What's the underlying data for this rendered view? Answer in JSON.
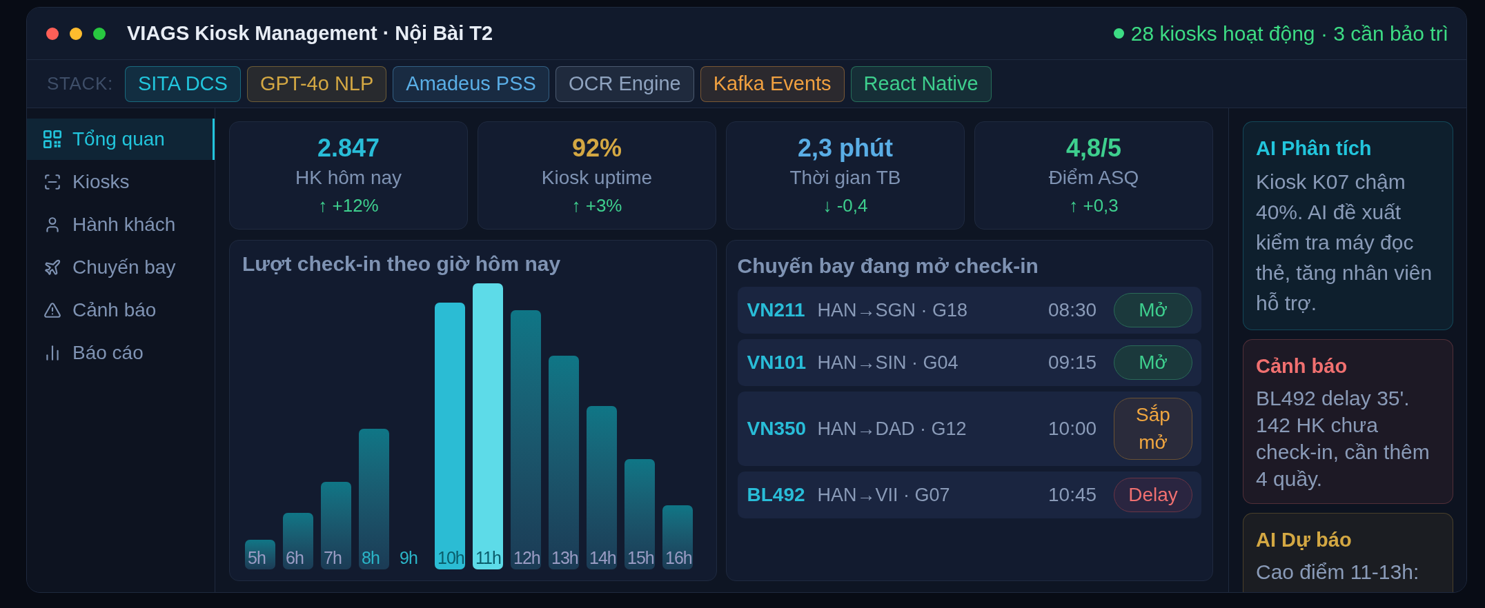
{
  "window": {
    "title": "VIAGS Kiosk Management · Nội Bài T2",
    "status": "28 kiosks hoạt động · 3 cần bảo trì"
  },
  "stack": {
    "label": "STACK:",
    "chips": [
      {
        "label": "SITA DCS",
        "color": "#22c5dc"
      },
      {
        "label": "GPT-4o NLP",
        "color": "#d4a843"
      },
      {
        "label": "Amadeus PSS",
        "color": "#5aaee6"
      },
      {
        "label": "OCR Engine",
        "color": "#8fa3bf"
      },
      {
        "label": "Kafka Events",
        "color": "#f0a040"
      },
      {
        "label": "React Native",
        "color": "#3ecf8e"
      }
    ]
  },
  "sidebar": {
    "items": [
      {
        "label": "Tổng quan",
        "selected": true
      },
      {
        "label": "Kiosks",
        "selected": false
      },
      {
        "label": "Hành khách",
        "selected": false
      },
      {
        "label": "Chuyến bay",
        "selected": false
      },
      {
        "label": "Cảnh báo",
        "selected": false
      },
      {
        "label": "Báo cáo",
        "selected": false
      }
    ]
  },
  "stats": [
    {
      "value": "2.847",
      "label": "HK hôm nay",
      "delta": "↑ +12%",
      "color": "#29bdd8"
    },
    {
      "value": "92%",
      "label": "Kiosk uptime",
      "delta": "↑ +3%",
      "color": "#d4a843"
    },
    {
      "value": "2,3 phút",
      "label": "Thời gian TB",
      "delta": "↓ -0,4",
      "color": "#5aaee6"
    },
    {
      "value": "4,8/5",
      "label": "Điểm ASQ",
      "delta": "↑ +0,3",
      "color": "#3ecf8e"
    }
  ],
  "checkin_chart": {
    "title": "Lượt check-in theo giờ hôm nay",
    "bars": [
      {
        "label": "5h",
        "kind": "normal",
        "highlighted": false
      },
      {
        "label": "6h",
        "kind": "normal",
        "highlighted": false
      },
      {
        "label": "7h",
        "kind": "normal",
        "highlighted": false
      },
      {
        "label": "8h",
        "kind": "normal",
        "highlighted": true
      },
      {
        "label": "9h",
        "kind": "none",
        "highlighted": true
      },
      {
        "label": "10h",
        "kind": "peak",
        "highlighted": true
      },
      {
        "label": "11h",
        "kind": "current",
        "highlighted": true
      },
      {
        "label": "12h",
        "kind": "normal",
        "highlighted": false
      },
      {
        "label": "13h",
        "kind": "normal",
        "highlighted": false
      },
      {
        "label": "14h",
        "kind": "normal",
        "highlighted": false
      },
      {
        "label": "15h",
        "kind": "normal",
        "highlighted": false
      },
      {
        "label": "16h",
        "kind": "normal",
        "highlighted": false
      }
    ]
  },
  "flights": {
    "title": "Chuyến bay đang mở check-in",
    "rows": [
      {
        "flight": "VN211",
        "route": "HAN→SGN · G18",
        "time": "08:30",
        "status": {
          "label": "Mở",
          "kind": "open"
        }
      },
      {
        "flight": "VN101",
        "route": "HAN→SIN · G04",
        "time": "09:15",
        "status": {
          "label": "Mở",
          "kind": "open"
        }
      },
      {
        "flight": "VN350",
        "route": "HAN→DAD · G12",
        "time": "10:00",
        "status": {
          "label": "Sắp mở",
          "kind": "soon"
        }
      },
      {
        "flight": "BL492",
        "route": "HAN→VII · G07",
        "time": "10:45",
        "status": {
          "label": "Delay",
          "kind": "delay"
        }
      }
    ]
  },
  "insights": [
    {
      "kind": "analysis",
      "title": "AI Phân tích",
      "text": "Kiosk K07 chậm 40%. AI đề xuất kiểm tra máy đọc thẻ, tăng nhân viên hỗ trợ.",
      "color": "#22c5dc"
    },
    {
      "kind": "alert",
      "title": "Cảnh báo",
      "text": "BL492 delay 35'. 142 HK chưa check-in, cần thêm 4 quầy.",
      "color": "#f07070"
    },
    {
      "kind": "forecast",
      "title": "AI Dự báo",
      "text": "Cao điểm 11-13h:",
      "color": "#d4a843"
    }
  ]
}
